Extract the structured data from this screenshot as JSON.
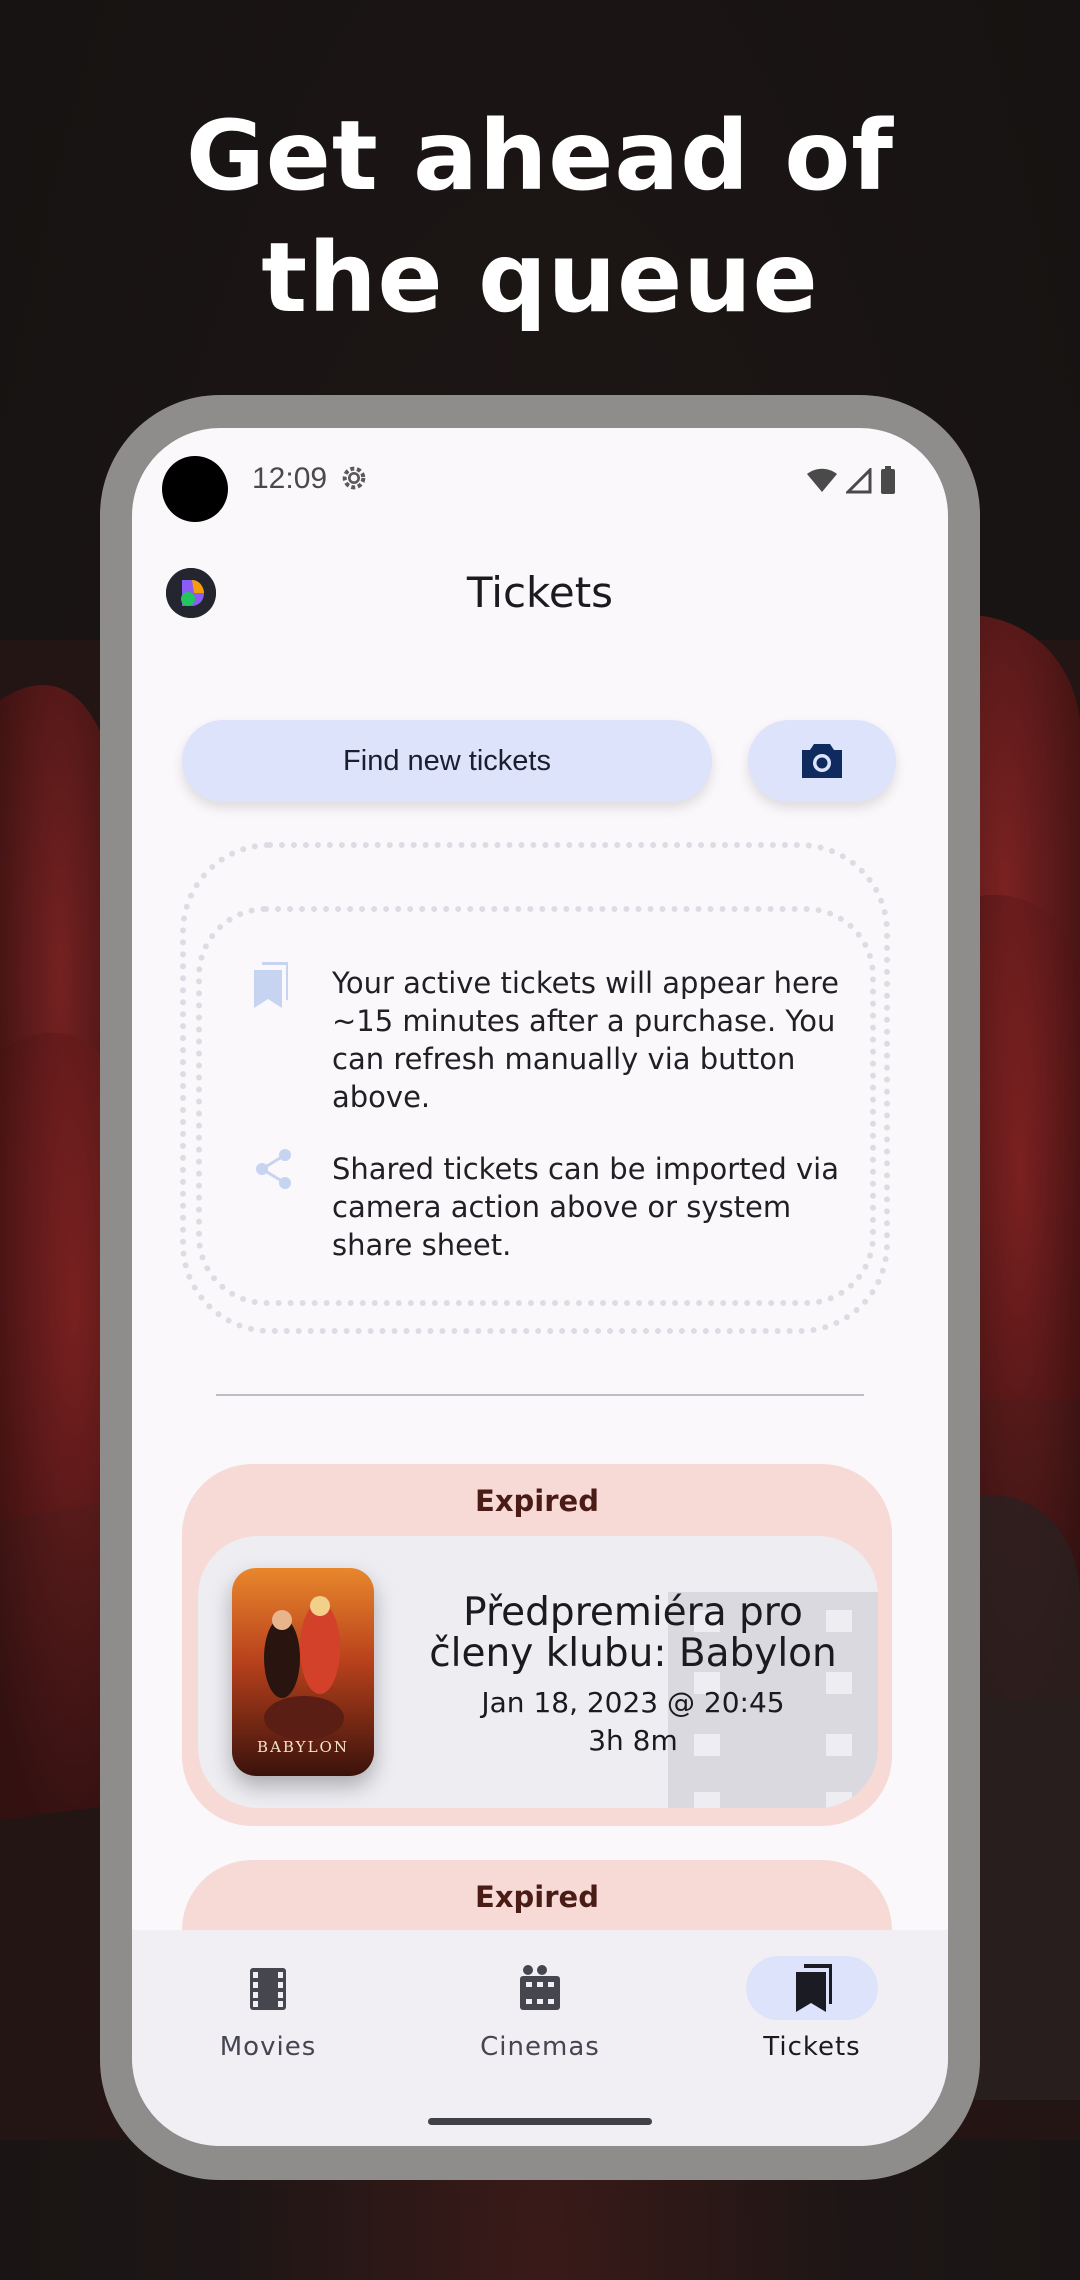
{
  "headline": {
    "line1": "Get ahead of",
    "line2": "the queue"
  },
  "status_bar": {
    "time": "12:09",
    "icons": [
      "settings-gear-icon",
      "wifi-icon",
      "signal-icon",
      "battery-icon"
    ]
  },
  "app_bar": {
    "title": "Tickets",
    "avatar_icon": "app-logo-icon"
  },
  "actions": {
    "find_tickets_label": "Find new tickets",
    "camera_icon": "camera-icon"
  },
  "info": {
    "active_tickets_text": "Your active tickets will appear here ~15 minutes after a purchase. You can refresh manually via button above.",
    "shared_tickets_text": "Shared tickets can be imported via camera action above or system share sheet.",
    "active_icon": "bookmark-icon",
    "shared_icon": "share-icon"
  },
  "tickets": [
    {
      "status": "Expired",
      "title": "Předpremiéra pro členy klubu: Babylon",
      "date": "Jan 18, 2023 @ 20:45",
      "duration": "3h 8m",
      "poster_text": "BABYLON"
    },
    {
      "status": "Expired"
    }
  ],
  "bottom_nav": {
    "items": [
      {
        "label": "Movies",
        "icon": "film-icon",
        "selected": false
      },
      {
        "label": "Cinemas",
        "icon": "cinema-icon",
        "selected": false
      },
      {
        "label": "Tickets",
        "icon": "tickets-icon",
        "selected": true
      }
    ]
  },
  "colors": {
    "screen_bg": "#fbf8fb",
    "button_bg": "#dde3fb",
    "expired_card_bg": "#f7dad6",
    "nav_bg": "#f1eef4",
    "selected_pill": "#dde3fb"
  }
}
